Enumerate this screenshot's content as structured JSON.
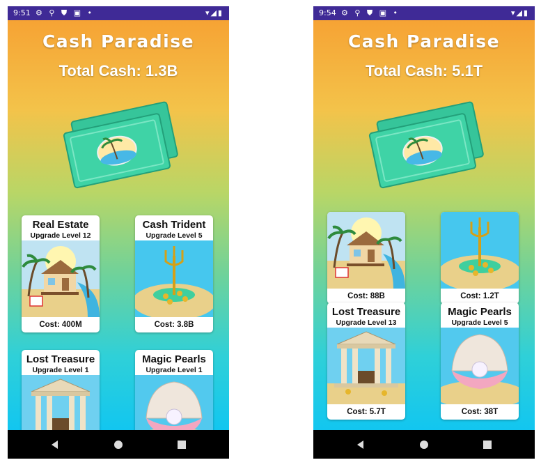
{
  "left": {
    "status": {
      "time": "9:51",
      "icons": "⚙ ⚲ ⛊ ▣ •",
      "right": "▾◢▮"
    },
    "title": "Cash Paradise",
    "total_cash": "Total Cash: 1.3B",
    "cards": [
      {
        "name": "Real Estate",
        "level": "Upgrade Level 12",
        "cost": "Cost: 400M",
        "art": "beach-house"
      },
      {
        "name": "Cash Trident",
        "level": "Upgrade Level 5",
        "cost": "Cost: 3.8B",
        "art": "trident"
      },
      {
        "name": "Lost Treasure",
        "level": "Upgrade Level 1",
        "cost": "",
        "art": "temple"
      },
      {
        "name": "Magic Pearls",
        "level": "Upgrade Level 1",
        "cost": "",
        "art": "pearl-shell"
      }
    ]
  },
  "right": {
    "status": {
      "time": "9:54",
      "icons": "⚙ ⚲ ⛊ ▣ •",
      "right": "▾◢▮"
    },
    "title": "Cash Paradise",
    "total_cash": "Total Cash: 5.1T",
    "cards": [
      {
        "name": "",
        "level": "",
        "cost": "Cost: 88B",
        "art": "beach-house"
      },
      {
        "name": "",
        "level": "",
        "cost": "Cost: 1.2T",
        "art": "trident"
      },
      {
        "name": "Lost Treasure",
        "level": "Upgrade Level 13",
        "cost": "Cost: 5.7T",
        "art": "temple"
      },
      {
        "name": "Magic Pearls",
        "level": "Upgrade Level 5",
        "cost": "Cost: 38T",
        "art": "pearl-shell"
      }
    ]
  },
  "icons": {
    "hero": "money-bills-icon",
    "nav": [
      "back-triangle-icon",
      "home-circle-icon",
      "recent-square-icon"
    ]
  },
  "colors": {
    "status_bar": "#3f2a96",
    "gradient_top": "#f6a334",
    "gradient_bottom": "#12c6f0",
    "bill": "#3fd3a6"
  }
}
